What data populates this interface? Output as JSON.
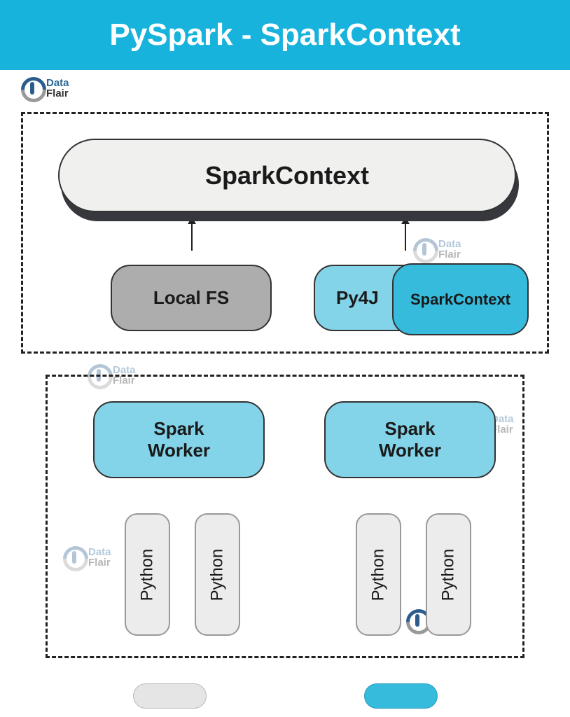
{
  "title": "PySpark - SparkContext",
  "logo": {
    "line1": "Data",
    "line2": "Flair"
  },
  "driver": {
    "sparkcontext": "SparkContext",
    "localfs": "Local FS",
    "py4j": "Py4J",
    "inner_sparkcontext": "SparkContext"
  },
  "workers": {
    "worker1": "Spark\nWorker",
    "worker2": "Spark\nWorker",
    "python": "Python"
  },
  "colors": {
    "accent": "#17b3dd",
    "node_blue_light": "#83d3e9",
    "node_blue": "#36bbdd",
    "grey": "#adadad"
  }
}
